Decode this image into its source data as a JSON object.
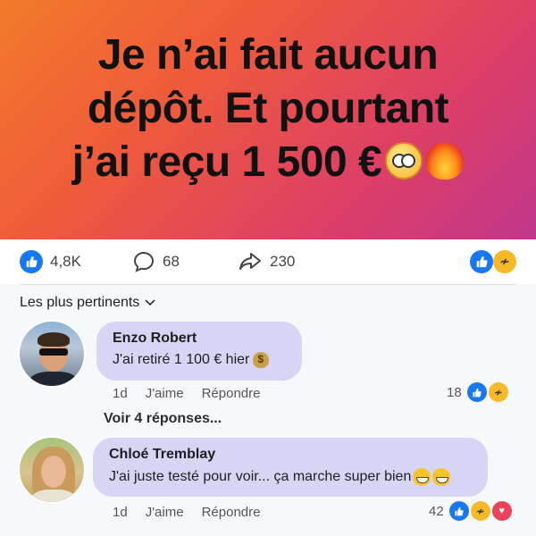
{
  "post": {
    "headline_lines": [
      "Je n’ai fait aucun",
      "dépôt. Et pourtant",
      "j’ai reçu 1 500 €"
    ],
    "headline_emojis": [
      "flushed-face-icon",
      "fire-icon"
    ]
  },
  "stats": {
    "likes": "4,8K",
    "comments": "68",
    "shares": "230"
  },
  "sort_label": "Les plus pertinents",
  "comments": [
    {
      "author": "Enzo Robert",
      "text": "J'ai retiré 1 100 € hier",
      "emoji": "money-bag-icon",
      "time": "1d",
      "like_label": "J'aime",
      "reply_label": "Répondre",
      "reactions_count": "18"
    },
    {
      "author": "Chloé Tremblay",
      "text": "J'ai juste testé pour voir... ça marche super bien",
      "emoji": "grinning-face-icon",
      "time": "1d",
      "like_label": "J'aime",
      "reply_label": "Répondre",
      "reactions_count": "42"
    }
  ],
  "view_replies": "Voir 4 réponses...",
  "colors": {
    "like_blue": "#1877f2",
    "bubble": "#d6d5f3",
    "banner_start": "#f37a2a",
    "banner_end": "#c0378a"
  }
}
